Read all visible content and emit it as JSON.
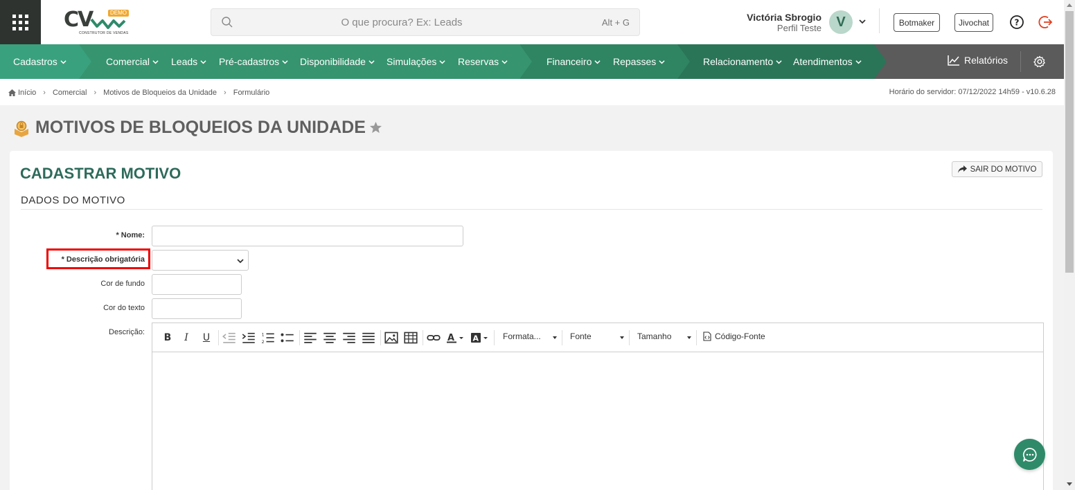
{
  "header": {
    "logo_text": "CV",
    "logo_badge": "DEMO",
    "logo_subtitle": "CONSTRUTOR DE VENDAS",
    "search_placeholder": "O que procura? Ex: Leads",
    "search_shortcut": "Alt + G",
    "user_name": "Victória Sbrogio",
    "user_profile": "Perfil Teste",
    "avatar_letter": "V",
    "botmaker_label": "Botmaker",
    "jivochat_label": "Jivochat"
  },
  "nav": {
    "items": [
      {
        "label": "Cadastros"
      },
      {
        "label": "Comercial"
      },
      {
        "label": "Leads"
      },
      {
        "label": "Pré-cadastros"
      },
      {
        "label": "Disponibilidade"
      },
      {
        "label": "Simulações"
      },
      {
        "label": "Reservas"
      },
      {
        "label": "Financeiro"
      },
      {
        "label": "Repasses"
      },
      {
        "label": "Relacionamento"
      },
      {
        "label": "Atendimentos"
      }
    ],
    "reports_label": "Relatórios",
    "colors": {
      "seg1": "#3aa17e",
      "seg2": "#36946f",
      "seg3": "#2f8462",
      "seg4": "#2a7558",
      "gray": "#5b5b5b"
    }
  },
  "breadcrumb": {
    "items": [
      "Início",
      "Comercial",
      "Motivos de Bloqueios da Unidade",
      "Formulário"
    ],
    "server_time": "Horário do servidor: 07/12/2022 14h59 - v10.6.28"
  },
  "page": {
    "title": "MOTIVOS DE BLOQUEIOS DA UNIDADE"
  },
  "form": {
    "card_title": "CADASTRAR MOTIVO",
    "exit_label": "SAIR DO MOTIVO",
    "section_title": "DADOS DO MOTIVO",
    "nome_label": "* Nome:",
    "nome_value": "",
    "descricao_obrig_label": "* Descrição obrigatória",
    "descricao_obrig_value": "",
    "cor_fundo_label": "Cor de fundo",
    "cor_texto_label": "Cor do texto",
    "descricao_label": "Descrição:",
    "toolbar": {
      "format_label": "Formata...",
      "font_label": "Fonte",
      "size_label": "Tamanho",
      "source_label": "Código-Fonte"
    }
  }
}
